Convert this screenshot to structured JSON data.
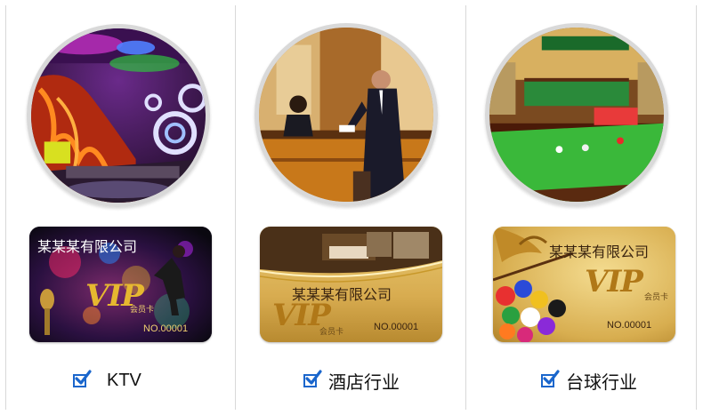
{
  "columns": [
    {
      "label": "KTV",
      "checked": true,
      "scene": "ktv-room",
      "card": {
        "company": "某某某有限公司",
        "vip": "VIP",
        "member": "会员卡",
        "number": "NO.00001",
        "style": "dark-neon"
      }
    },
    {
      "label": "酒店行业",
      "checked": true,
      "scene": "hotel-reception",
      "card": {
        "company": "某某某有限公司",
        "vip": "VIP",
        "member": "会员卡",
        "number": "NO.00001",
        "style": "gold-hotel"
      }
    },
    {
      "label": "台球行业",
      "checked": true,
      "scene": "billiards-hall",
      "card": {
        "company": "某某某有限公司",
        "vip": "VIP",
        "member": "会员卡",
        "number": "NO.00001",
        "style": "gold-billiards"
      }
    }
  ],
  "colors": {
    "check_blue": "#1a66cc",
    "divider": "#d8d8d8",
    "gold": "#d4a830",
    "vip_gold": "#c8901a"
  }
}
